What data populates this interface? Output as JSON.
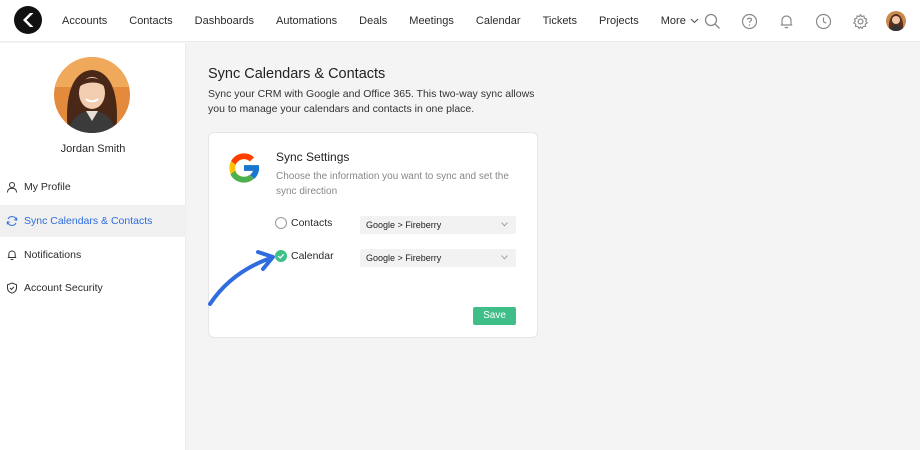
{
  "nav": {
    "items": [
      "Accounts",
      "Contacts",
      "Dashboards",
      "Automations",
      "Deals",
      "Meetings",
      "Calendar",
      "Tickets",
      "Projects"
    ],
    "more_label": "More"
  },
  "toolbar_icons": [
    "search-icon",
    "help-icon",
    "bell-icon",
    "clock-icon",
    "gear-icon"
  ],
  "sidebar": {
    "profile_name": "Jordan Smith",
    "items": [
      {
        "label": "My Profile",
        "icon": "user-icon",
        "active": false
      },
      {
        "label": "Sync Calendars & Contacts",
        "icon": "sync-icon",
        "active": true
      },
      {
        "label": "Notifications",
        "icon": "bell-icon",
        "active": false
      },
      {
        "label": "Account Security",
        "icon": "shield-icon",
        "active": false
      }
    ]
  },
  "main": {
    "title": "Sync Calendars & Contacts",
    "description": "Sync your CRM with Google and Office 365. This two-way sync allows you to manage your calendars and contacts in one place."
  },
  "card": {
    "title": "Sync Settings",
    "description": "Choose the information you want to sync and set the sync direction",
    "rows": [
      {
        "label": "Contacts",
        "direction": "Google > Fireberry",
        "checked": false
      },
      {
        "label": "Calendar",
        "direction": "Google > Fireberry",
        "checked": true
      }
    ],
    "save_label": "Save"
  },
  "colors": {
    "accent_blue": "#2f6ce0",
    "save_green": "#3fbe8a",
    "check_green": "#3dbf88",
    "annotation_arrow": "#2f6ce0"
  }
}
